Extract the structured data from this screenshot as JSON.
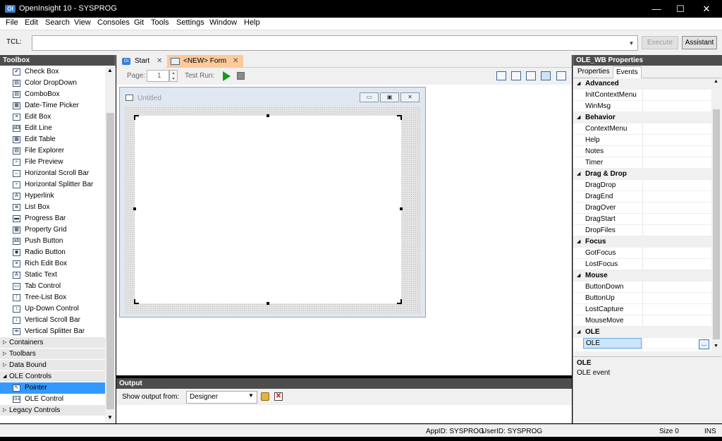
{
  "window": {
    "title": "OpenInsight 10 - SYSPROG",
    "icon_text": "OI",
    "minimize_glyph": "—",
    "maximize_glyph": "☐",
    "close_glyph": "✕"
  },
  "menu": [
    "File",
    "Edit",
    "Search",
    "View",
    "Consoles",
    "Git",
    "Tools",
    "Settings",
    "Window",
    "Help"
  ],
  "tcl": {
    "label": "TCL:",
    "value": "",
    "execute_label": "Execute",
    "assistant_label": "Assistant"
  },
  "toolbox": {
    "title": "Toolbox",
    "items": [
      {
        "label": "Check Box",
        "icon": "check-box-icon",
        "glyph": "✔"
      },
      {
        "label": "Color DropDown",
        "icon": "color-dropdown-icon",
        "glyph": "▤"
      },
      {
        "label": "ComboBox",
        "icon": "combobox-icon",
        "glyph": "▤"
      },
      {
        "label": "Date-Time Picker",
        "icon": "date-time-picker-icon",
        "glyph": "▦"
      },
      {
        "label": "Edit Box",
        "icon": "edit-box-icon",
        "glyph": "≡"
      },
      {
        "label": "Edit Line",
        "icon": "edit-line-icon",
        "glyph": "abl"
      },
      {
        "label": "Edit Table",
        "icon": "edit-table-icon",
        "glyph": "▦"
      },
      {
        "label": "File Explorer",
        "icon": "file-explorer-icon",
        "glyph": "▤"
      },
      {
        "label": "File Preview",
        "icon": "file-preview-icon",
        "glyph": "⌕"
      },
      {
        "label": "Horizontal Scroll Bar",
        "icon": "horizontal-scroll-bar-icon",
        "glyph": "↔"
      },
      {
        "label": "Horizontal Splitter Bar",
        "icon": "horizontal-splitter-bar-icon",
        "glyph": "÷"
      },
      {
        "label": "Hyperlink",
        "icon": "hyperlink-icon",
        "glyph": "A"
      },
      {
        "label": "List Box",
        "icon": "list-box-icon",
        "glyph": "≣"
      },
      {
        "label": "Progress Bar",
        "icon": "progress-bar-icon",
        "glyph": "▬"
      },
      {
        "label": "Property Grid",
        "icon": "property-grid-icon",
        "glyph": "▦"
      },
      {
        "label": "Push Button",
        "icon": "push-button-icon",
        "glyph": "ab"
      },
      {
        "label": "Radio Button",
        "icon": "radio-button-icon",
        "glyph": "◉"
      },
      {
        "label": "Rich Edit Box",
        "icon": "rich-edit-box-icon",
        "glyph": "≡"
      },
      {
        "label": "Static Text",
        "icon": "static-text-icon",
        "glyph": "A"
      },
      {
        "label": "Tab Control",
        "icon": "tab-control-icon",
        "glyph": "▭"
      },
      {
        "label": "Tree-List Box",
        "icon": "tree-list-box-icon",
        "glyph": "⋮"
      },
      {
        "label": "Up-Down Control",
        "icon": "up-down-control-icon",
        "glyph": "↕"
      },
      {
        "label": "Vertical Scroll Bar",
        "icon": "vertical-scroll-bar-icon",
        "glyph": "↕"
      },
      {
        "label": "Vertical Splitter Bar",
        "icon": "vertical-splitter-bar-icon",
        "glyph": "⇹"
      }
    ],
    "groups": [
      {
        "label": "Containers",
        "expanded": false
      },
      {
        "label": "Toolbars",
        "expanded": false
      },
      {
        "label": "Data Bound",
        "expanded": false
      },
      {
        "label": "OLE Controls",
        "expanded": true
      }
    ],
    "ole_items": [
      {
        "label": "Pointer",
        "icon": "pointer-icon",
        "glyph": "↖",
        "selected": true
      },
      {
        "label": "OLE Control",
        "icon": "ole-control-icon",
        "glyph": "OLE",
        "selected": false
      }
    ],
    "legacy_group": {
      "label": "Legacy Controls",
      "expanded": false
    }
  },
  "tabs": [
    {
      "label": "Start",
      "icon": "openinsight-icon",
      "active": false
    },
    {
      "label": "<NEW> Form",
      "icon": "form-icon",
      "active": true
    }
  ],
  "designer_toolbar": {
    "page_label": "Page:",
    "page_value": "1",
    "test_run_label": "Test Run:"
  },
  "form": {
    "title": "Untitled"
  },
  "output": {
    "title": "Output",
    "show_label": "Show output from:",
    "selected": "Designer"
  },
  "properties": {
    "title": "OLE_WB Properties",
    "tabs": [
      "Properties",
      "Events"
    ],
    "active_tab": "Events",
    "categories": [
      {
        "name": "Advanced",
        "items": [
          "InitContextMenu",
          "WinMsg"
        ]
      },
      {
        "name": "Behavior",
        "items": [
          "ContextMenu",
          "Help",
          "Notes",
          "Timer"
        ]
      },
      {
        "name": "Drag & Drop",
        "items": [
          "DragDrop",
          "DragEnd",
          "DragOver",
          "DragStart",
          "DropFiles"
        ]
      },
      {
        "name": "Focus",
        "items": [
          "GotFocus",
          "LostFocus"
        ]
      },
      {
        "name": "Mouse",
        "items": [
          "ButtonDown",
          "ButtonUp",
          "LostCapture",
          "MouseMove"
        ]
      },
      {
        "name": "OLE",
        "items": [
          "OLE"
        ]
      }
    ],
    "selected_item": "OLE",
    "ellipsis": "...",
    "description_title": "OLE",
    "description_text": "OLE event"
  },
  "status": {
    "appid": "AppID: SYSPROG",
    "userid": "UserID: SYSPROG",
    "size": "Size 0",
    "mode": "INS"
  },
  "colors": {
    "accent": "#3399ff",
    "active_tab": "#fcc99a",
    "panel_header": "#4d4d4d",
    "play": "#1b9a1b"
  }
}
